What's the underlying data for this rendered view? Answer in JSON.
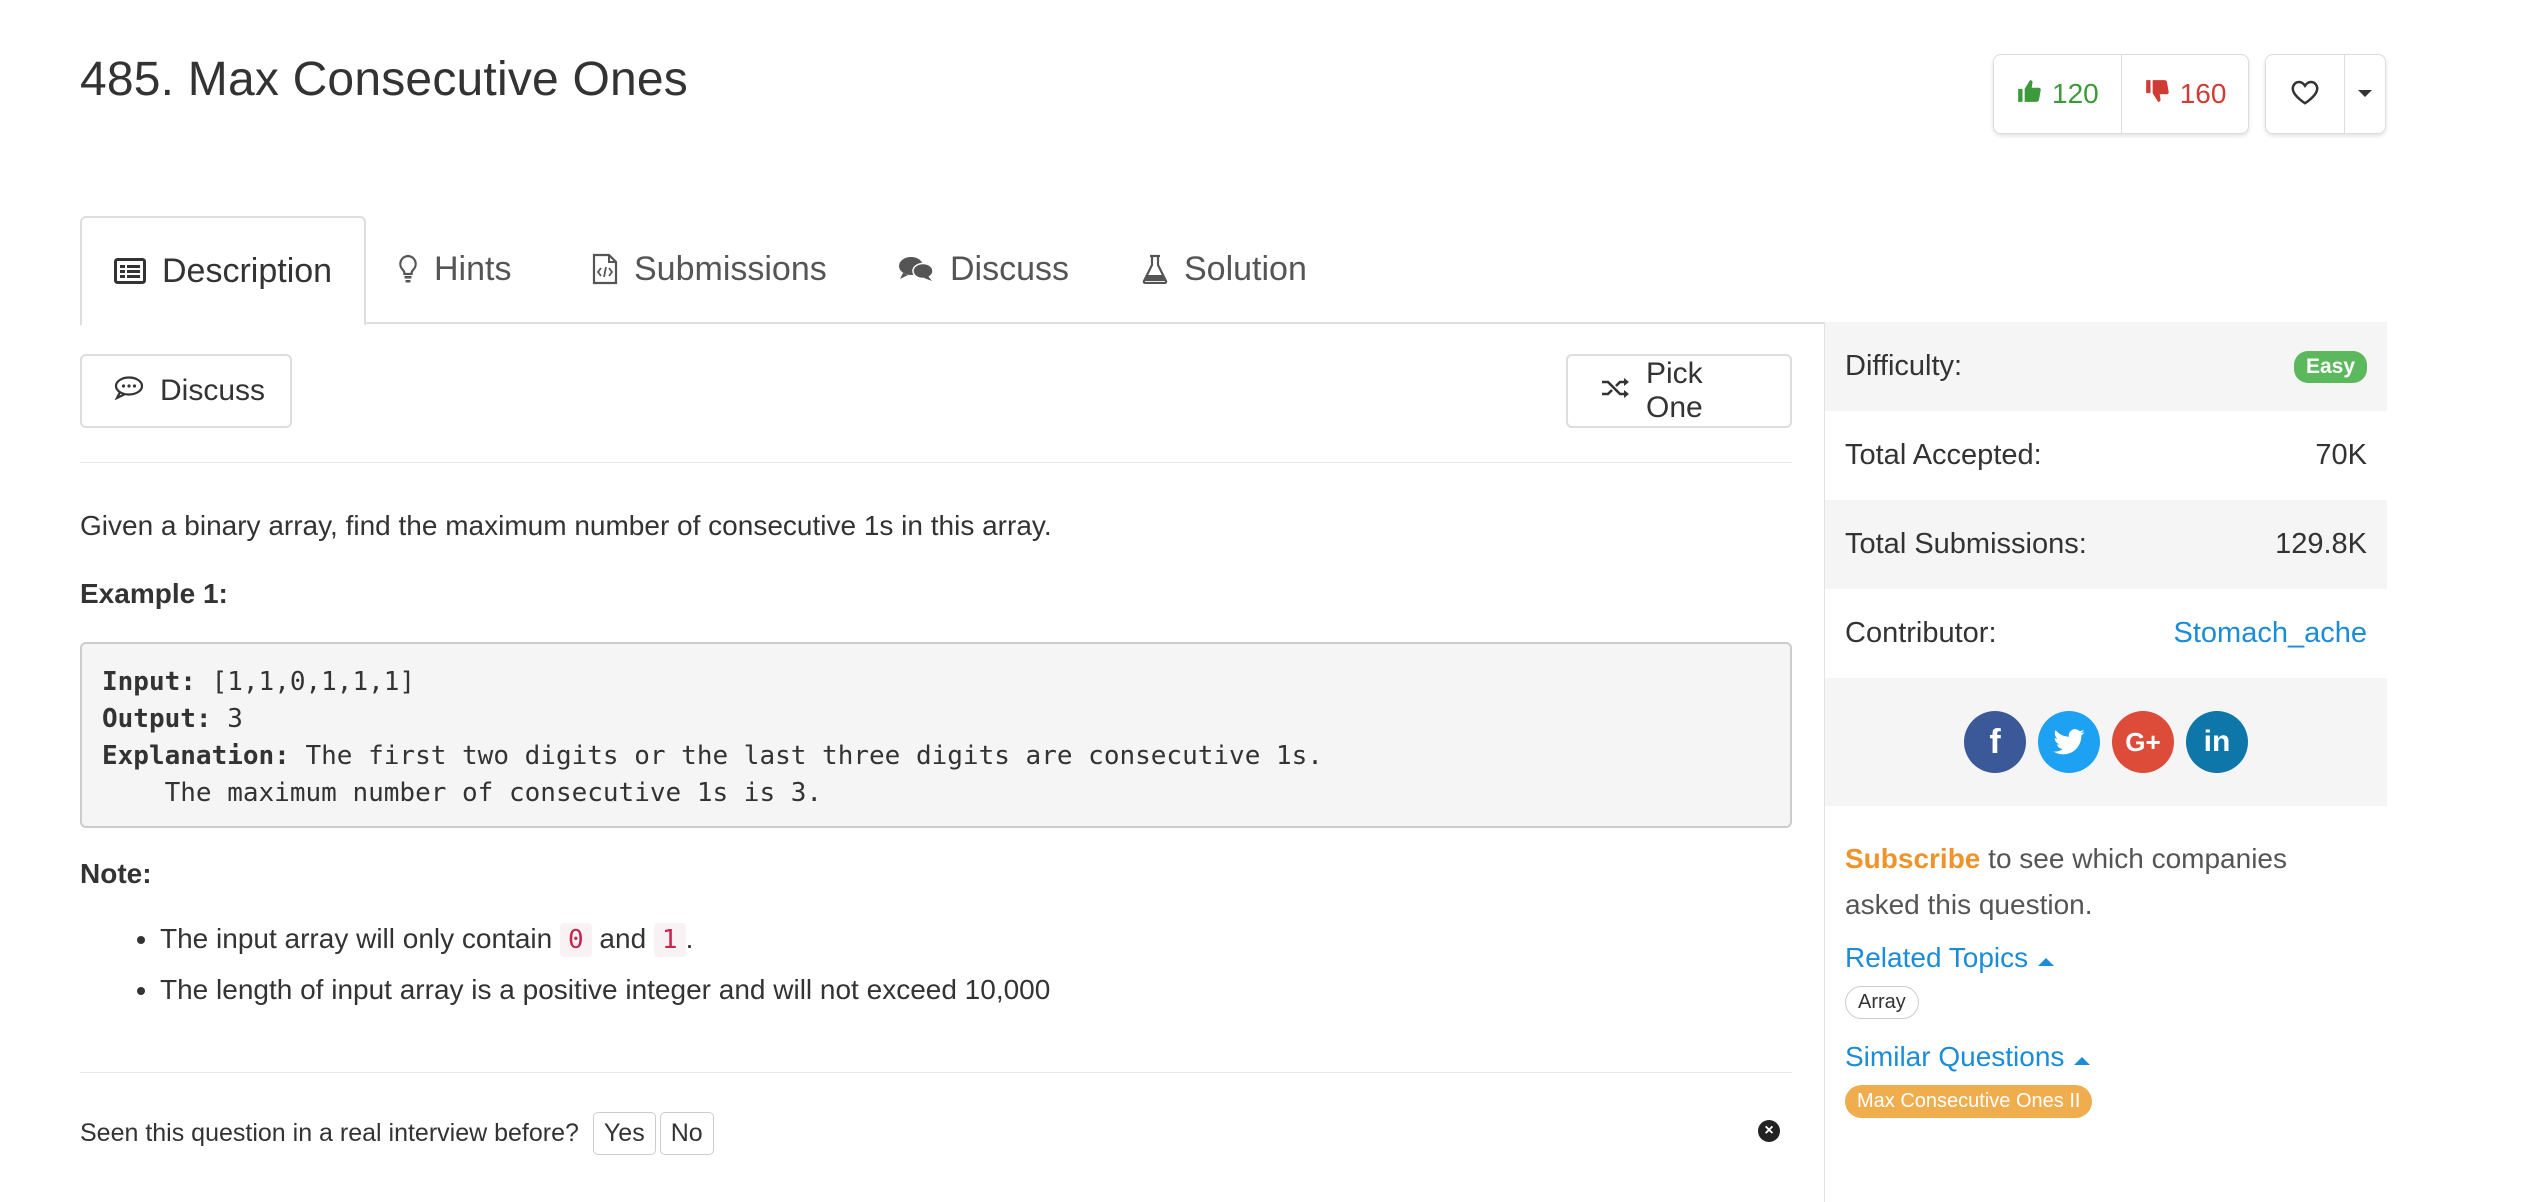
{
  "problem": {
    "title": "485. Max Consecutive Ones"
  },
  "votes": {
    "up": "120",
    "down": "160"
  },
  "tabs": [
    {
      "label": "Description",
      "icon": "description-icon"
    },
    {
      "label": "Hints",
      "icon": "lightbulb-icon"
    },
    {
      "label": "Submissions",
      "icon": "code-file-icon"
    },
    {
      "label": "Discuss",
      "icon": "chat-bubbles-icon"
    },
    {
      "label": "Solution",
      "icon": "flask-icon"
    }
  ],
  "actions": {
    "discuss": "Discuss",
    "pick_one": "Pick One"
  },
  "content": {
    "description": "Given a binary array, find the maximum number of consecutive 1s in this array.",
    "example_heading": "Example 1:",
    "input_label": "Input:",
    "input_value": " [1,1,0,1,1,1]",
    "output_label": "Output:",
    "output_value": " 3",
    "explanation_label": "Explanation:",
    "explanation_value": " The first two digits or the last three digits are consecutive 1s.",
    "explanation_cont": "    The maximum number of consecutive 1s is 3.",
    "note_heading": "Note:",
    "note1_pre": "The input array will only contain ",
    "note1_code1": "0",
    "note1_mid": " and ",
    "note1_code2": "1",
    "note1_post": ".",
    "note2": "The length of input array is a positive integer and will not exceed 10,000"
  },
  "feedback": {
    "question": "Seen this question in a real interview before?",
    "yes": "Yes",
    "no": "No"
  },
  "sidebar": {
    "difficulty_label": "Difficulty:",
    "difficulty_value": "Easy",
    "accepted_label": "Total Accepted:",
    "accepted_value": "70K",
    "submissions_label": "Total Submissions:",
    "submissions_value": "129.8K",
    "contributor_label": "Contributor:",
    "contributor_value": "Stomach_ache",
    "subscribe_link": "Subscribe",
    "subscribe_text": " to see which companies asked this question.",
    "related_topics": "Related Topics",
    "topic_tag": "Array",
    "similar_questions": "Similar Questions",
    "similar_tag": "Max Consecutive Ones II"
  },
  "colors": {
    "upvote": "#3d9a3a",
    "downvote": "#cf3b35",
    "link": "#1a8cd8",
    "easy": "#5cb85c",
    "subscribe": "#f0932b",
    "similar": "#f0ad4e"
  }
}
